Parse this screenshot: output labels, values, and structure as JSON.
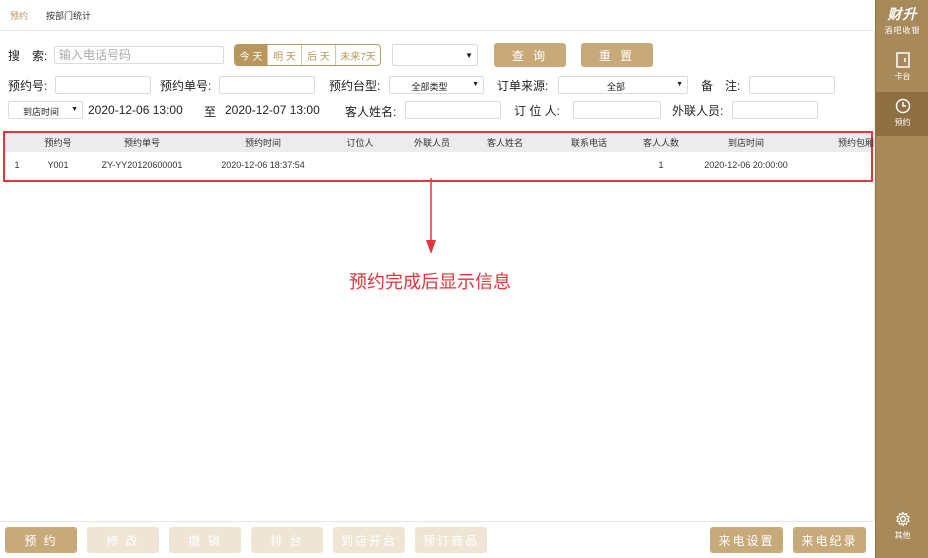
{
  "tabs": [
    "预约",
    "按部门统计"
  ],
  "sidebar": {
    "brand_main": "财升",
    "brand_sub": "酒吧收银",
    "items": [
      "卡台",
      "预约",
      "其他"
    ]
  },
  "search": {
    "label": "搜　索:",
    "placeholder": "输入电话号码",
    "segments": [
      "今 天",
      "明 天",
      "后 天",
      "未来7天"
    ],
    "query_button": "查 询",
    "reset_button": "重 置"
  },
  "row2": {
    "resv_no_label": "预约号:",
    "resv_order_label": "预约单号:",
    "table_type_label": "预约台型:",
    "table_type_value": "全部类型",
    "source_label": "订单来源:",
    "source_value": "全部",
    "remark_label": "备　注:"
  },
  "row3": {
    "time_type": "到店时间",
    "start_time": "2020-12-06 13:00",
    "to_label": "至",
    "end_time": "2020-12-07 13:00",
    "guest_label": "客人姓名:",
    "booker_label": "订 位 人:",
    "staff_label": "外联人员:"
  },
  "table": {
    "headers": [
      "预约号",
      "预约单号",
      "预约时间",
      "订位人",
      "外联人员",
      "客人姓名",
      "联系电话",
      "客人人数",
      "到店时间",
      "预约包厢"
    ],
    "rows": [
      [
        "1",
        "Y001",
        "ZY-YY20120600001",
        "2020-12-06 18:37:54",
        "",
        "",
        "",
        "",
        "1",
        "2020-12-06 20:00:00"
      ]
    ]
  },
  "annotation": "预约完成后显示信息",
  "bottom": {
    "left_buttons": [
      "预 约",
      "修 改",
      "撤 销",
      "排 台",
      "到店开台",
      "预订商品"
    ],
    "right_buttons": [
      "来电设置",
      "来电纪录"
    ]
  },
  "colors": {
    "accent": "#b8975e",
    "sidebar": "#a88a5a",
    "highlight": "#e8333a"
  }
}
